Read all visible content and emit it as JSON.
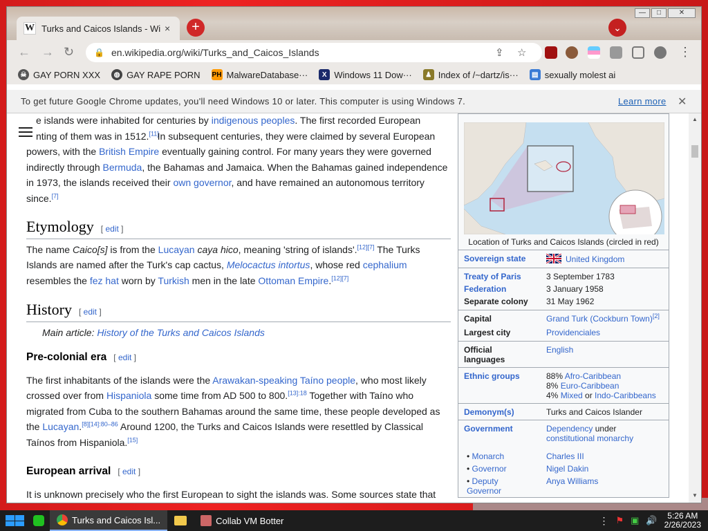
{
  "browser": {
    "tab_title": "Turks and Caicos Islands - Wiki",
    "tab_close": "×",
    "new_tab": "+",
    "tab_search": "⌄",
    "url": "en.wikipedia.org/wiki/Turks_and_Caicos_Islands",
    "bookmarks": [
      {
        "label": "GAY PORN XXX",
        "icon": "skull-icon"
      },
      {
        "label": "GAY RAPE PORN",
        "icon": "globe-icon"
      },
      {
        "label": "MalwareDatabase···",
        "icon": "ph-icon"
      },
      {
        "label": "Windows 11 Dow···",
        "icon": "x-icon"
      },
      {
        "label": "Index of /~dartz/is···",
        "icon": "person-icon"
      },
      {
        "label": "sexually molest ai",
        "icon": "page-icon"
      }
    ],
    "infobar": {
      "message": "To get future Google Chrome updates, you'll need Windows 10 or later. This computer is using Windows 7.",
      "link": "Learn more",
      "close": "✕"
    }
  },
  "article": {
    "p1": {
      "a": "e islands were inhabited for centuries by ",
      "a_link": "indigenous peoples",
      "b": ". The first recorded European",
      "c": "nting of them was in 1512.",
      "c_sup": "[11]",
      "d": " In subsequent centuries, they were claimed by several European powers, with the ",
      "d_link": "British Empire",
      "e": " eventually gaining control. For many years they were governed indirectly through ",
      "e_link": "Bermuda",
      "f": ", the Bahamas and Jamaica. When the Bahamas gained independence in 1973, the islands received their ",
      "f_link": "own governor",
      "g": ", and have remained an autonomous territory since.",
      "g_sup": "[7]"
    },
    "etymology": {
      "heading": "Etymology",
      "edit": "edit",
      "t1": "The name ",
      "t1_i": "Caico[s]",
      "t2": " is from the ",
      "t2_link": "Lucayan",
      "t3_i": " caya hico",
      "t4": ", meaning 'string of islands'.",
      "t4_sup": "[12][7]",
      "t5": " The Turks Islands are named after the Turk's cap cactus, ",
      "t5_link": "Melocactus intortus",
      "t6": ", whose red ",
      "t6_link": "cephalium",
      "t7": " resembles the ",
      "t7_link": "fez hat",
      "t8": " worn by ",
      "t8_link": "Turkish",
      "t9": " men in the late ",
      "t9_link": "Ottoman Empire",
      "t10": ".",
      "t10_sup": "[12][7]"
    },
    "history": {
      "heading": "History",
      "edit": "edit",
      "main_prefix": "Main article: ",
      "main_link": "History of the Turks and Caicos Islands"
    },
    "precolonial": {
      "heading": "Pre-colonial era",
      "edit": "edit",
      "t1": "The first inhabitants of the islands were the ",
      "t1_link": "Arawakan-speaking Taíno people",
      "t2": ", who most likely crossed over from ",
      "t2_link": "Hispaniola",
      "t3": " some time from AD 500 to 800.",
      "t3_sup": "[13]:18",
      "t4": " Together with Taíno who migrated from Cuba to the southern Bahamas around the same time, these people developed as the ",
      "t4_link": "Lucayan",
      "t5": ".",
      "t5_sup": "[8][14]:80–86",
      "t6": " Around 1200, the Turks and Caicos Islands were resettled by Classical Taínos from Hispaniola.",
      "t6_sup": "[15]"
    },
    "european": {
      "heading": "European arrival",
      "edit": "edit",
      "t1": "It is unknown precisely who the first European to sight the islands was. Some sources state that"
    }
  },
  "infobox": {
    "caption": "Location of Turks and Caicos Islands (circled in red)",
    "rows": {
      "sovereign_label": "Sovereign state",
      "sovereign_value": "United Kingdom",
      "treaty_label": "Treaty of Paris",
      "treaty_value": "3 September 1783",
      "federation_label": "Federation",
      "federation_value": "3 January 1958",
      "separate_label": "Separate colony",
      "separate_value": "31 May 1962",
      "capital_label": "Capital",
      "capital_value": "Grand Turk (Cockburn Town)",
      "capital_sup": "[2]",
      "largest_label": "Largest city",
      "largest_value": "Providenciales",
      "official_label": "Official languages",
      "official_value": "English",
      "ethnic_label": "Ethnic groups",
      "ethnic_1_pct": "88%",
      "ethnic_1": "Afro-Caribbean",
      "ethnic_2_pct": "8%",
      "ethnic_2": "Euro-Caribbean",
      "ethnic_3_pct": "4%",
      "ethnic_3a": "Mixed",
      "ethnic_3_or": " or ",
      "ethnic_3b": "Indo-Caribbeans",
      "demonym_label": "Demonym(s)",
      "demonym_value": "Turks and Caicos Islander",
      "government_label": "Government",
      "government_v1": "Dependency",
      "government_v2": " under ",
      "government_v3": "constitutional monarchy",
      "monarch_label": "Monarch",
      "monarch_value": "Charles III",
      "governor_label": "Governor",
      "governor_value": "Nigel Dakin",
      "deputy_label": "Deputy Governor",
      "deputy_value": "Anya Williams"
    }
  },
  "taskbar": {
    "chrome_item": "Turks and Caicos Isl...",
    "collab_item": "Collab VM Botter",
    "time": "5:26 AM",
    "date": "2/26/2023"
  },
  "colors": {
    "link": "#3366cc",
    "desktop": "#d31b1b",
    "taskbar": "#1d1d1d"
  }
}
